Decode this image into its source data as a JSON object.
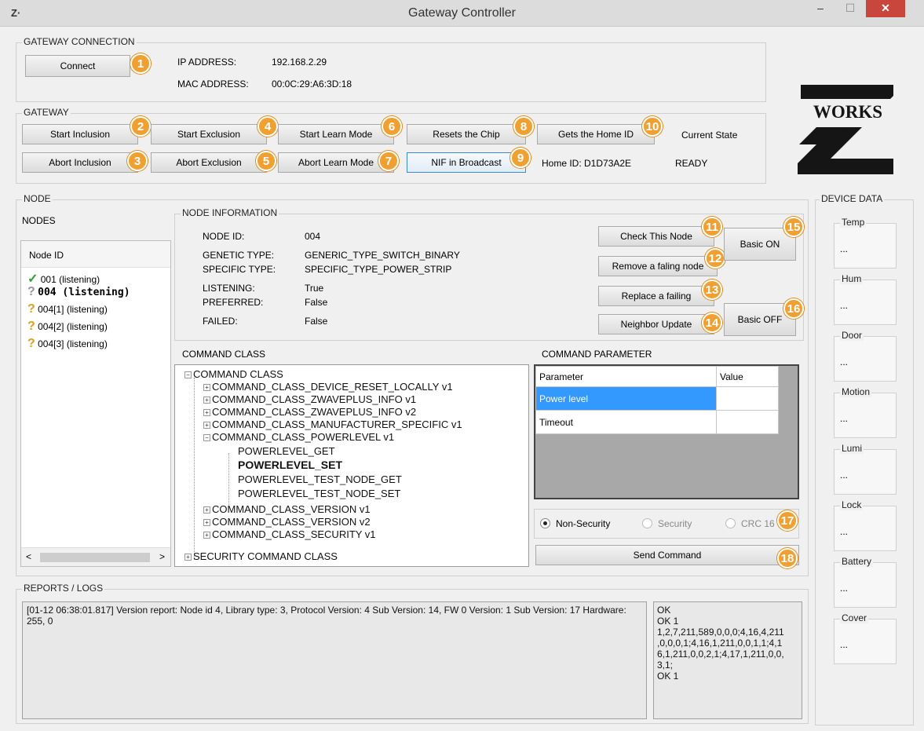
{
  "window": {
    "app_icon": "Z·",
    "title": "Gateway Controller",
    "min": "–",
    "max": "☐",
    "close": "✕"
  },
  "gateway_connection": {
    "label": "GATEWAY CONNECTION",
    "connect": "Connect",
    "ip_label": "IP ADDRESS:",
    "ip": "192.168.2.29",
    "mac_label": "MAC ADDRESS:",
    "mac": "00:0C:29:A6:3D:18"
  },
  "gateway": {
    "label": "GATEWAY",
    "start_inclusion": "Start Inclusion",
    "start_exclusion": "Start Exclusion",
    "start_learn": "Start Learn Mode",
    "reset_chip": "Resets the Chip",
    "get_home_id": "Gets the Home ID",
    "abort_inclusion": "Abort Inclusion",
    "abort_exclusion": "Abort Exclusion",
    "abort_learn": "Abort Learn Mode",
    "nif_broadcast": "NIF in Broadcast",
    "current_state_label": "Current State",
    "home_id": "Home ID: D1D73A2E",
    "state": "READY"
  },
  "logo": {
    "top": "WORKS"
  },
  "node": {
    "label": "NODE",
    "nodes_label": "NODES",
    "list_header": "Node ID",
    "items": [
      {
        "icon": "✓",
        "text": "001 (listening)"
      },
      {
        "icon": "?",
        "text": "004 (listening)"
      },
      {
        "icon": "?",
        "text": "004[1] (listening)"
      },
      {
        "icon": "?",
        "text": "004[2] (listening)"
      },
      {
        "icon": "?",
        "text": "004[3] (listening)"
      }
    ],
    "scroll_left": "<",
    "scroll_right": ">"
  },
  "node_info": {
    "label": "NODE INFORMATION",
    "rows": [
      {
        "k": "NODE ID:",
        "v": "004"
      },
      {
        "k": "GENETIC TYPE:",
        "v": "GENERIC_TYPE_SWITCH_BINARY"
      },
      {
        "k": "SPECIFIC TYPE:",
        "v": "SPECIFIC_TYPE_POWER_STRIP"
      },
      {
        "k": "LISTENING:",
        "v": "True"
      },
      {
        "k": "PREFERRED:",
        "v": "False"
      },
      {
        "k": "FAILED:",
        "v": "False"
      }
    ],
    "check_node": "Check This Node",
    "remove_failing": "Remove a faling node",
    "replace_failing": "Replace a failing",
    "neighbor_update": "Neighbor Update",
    "basic_on": "Basic ON",
    "basic_off": "Basic OFF"
  },
  "command_class": {
    "label": "COMMAND CLASS",
    "root": "COMMAND CLASS",
    "items": [
      "COMMAND_CLASS_DEVICE_RESET_LOCALLY v1",
      "COMMAND_CLASS_ZWAVEPLUS_INFO v1",
      "COMMAND_CLASS_ZWAVEPLUS_INFO v2",
      "COMMAND_CLASS_MANUFACTURER_SPECIFIC v1",
      "COMMAND_CLASS_POWERLEVEL v1"
    ],
    "sub": [
      "POWERLEVEL_GET",
      "POWERLEVEL_SET",
      "POWERLEVEL_TEST_NODE_GET",
      "POWERLEVEL_TEST_NODE_SET"
    ],
    "after": [
      "COMMAND_CLASS_VERSION v1",
      "COMMAND_CLASS_VERSION v2",
      "COMMAND_CLASS_SECURITY v1"
    ],
    "security": "SECURITY COMMAND CLASS"
  },
  "command_param": {
    "label": "COMMAND PARAMETER",
    "col_param": "Parameter",
    "col_value": "Value",
    "rows": [
      {
        "p": "Power level",
        "v": ""
      },
      {
        "p": "Timeout",
        "v": ""
      }
    ],
    "non_security": "Non-Security",
    "security": "Security",
    "crc": "CRC 16",
    "send": "Send Command"
  },
  "device_data": {
    "label": "DEVICE DATA",
    "items": [
      {
        "name": "Temp",
        "value": "..."
      },
      {
        "name": "Hum",
        "value": "..."
      },
      {
        "name": "Door",
        "value": "..."
      },
      {
        "name": "Motion",
        "value": "..."
      },
      {
        "name": "Lumi",
        "value": "..."
      },
      {
        "name": "Lock",
        "value": "..."
      },
      {
        "name": "Battery",
        "value": "..."
      },
      {
        "name": "Cover",
        "value": "..."
      }
    ]
  },
  "logs": {
    "label": "REPORTS / LOGS",
    "main": "[01-12 06:38:01.817] Version report: Node id 4, Library type: 3, Protocol Version: 4 Sub Version: 14, FW 0 Version: 1 Sub Version: 17 Hardware: 255, 0",
    "side_lines": [
      "OK",
      "OK 1",
      "1,2,7,211,589,0,0,0;4,16,4,211",
      ",0,0,0,1;4,16,1,211,0,0,1,1;4,1",
      "6,1,211,0,0,2,1;4,17,1,211,0,0,",
      "3,1;",
      "OK 1"
    ]
  },
  "badges": [
    "1",
    "2",
    "3",
    "4",
    "5",
    "6",
    "7",
    "8",
    "9",
    "10",
    "11",
    "12",
    "13",
    "14",
    "15",
    "16",
    "17",
    "18"
  ],
  "colors": {
    "badge": "#f0a030",
    "close": "#c8463c",
    "selection": "#3399ff",
    "check": "#2ea02e",
    "question": "#e0a020"
  }
}
